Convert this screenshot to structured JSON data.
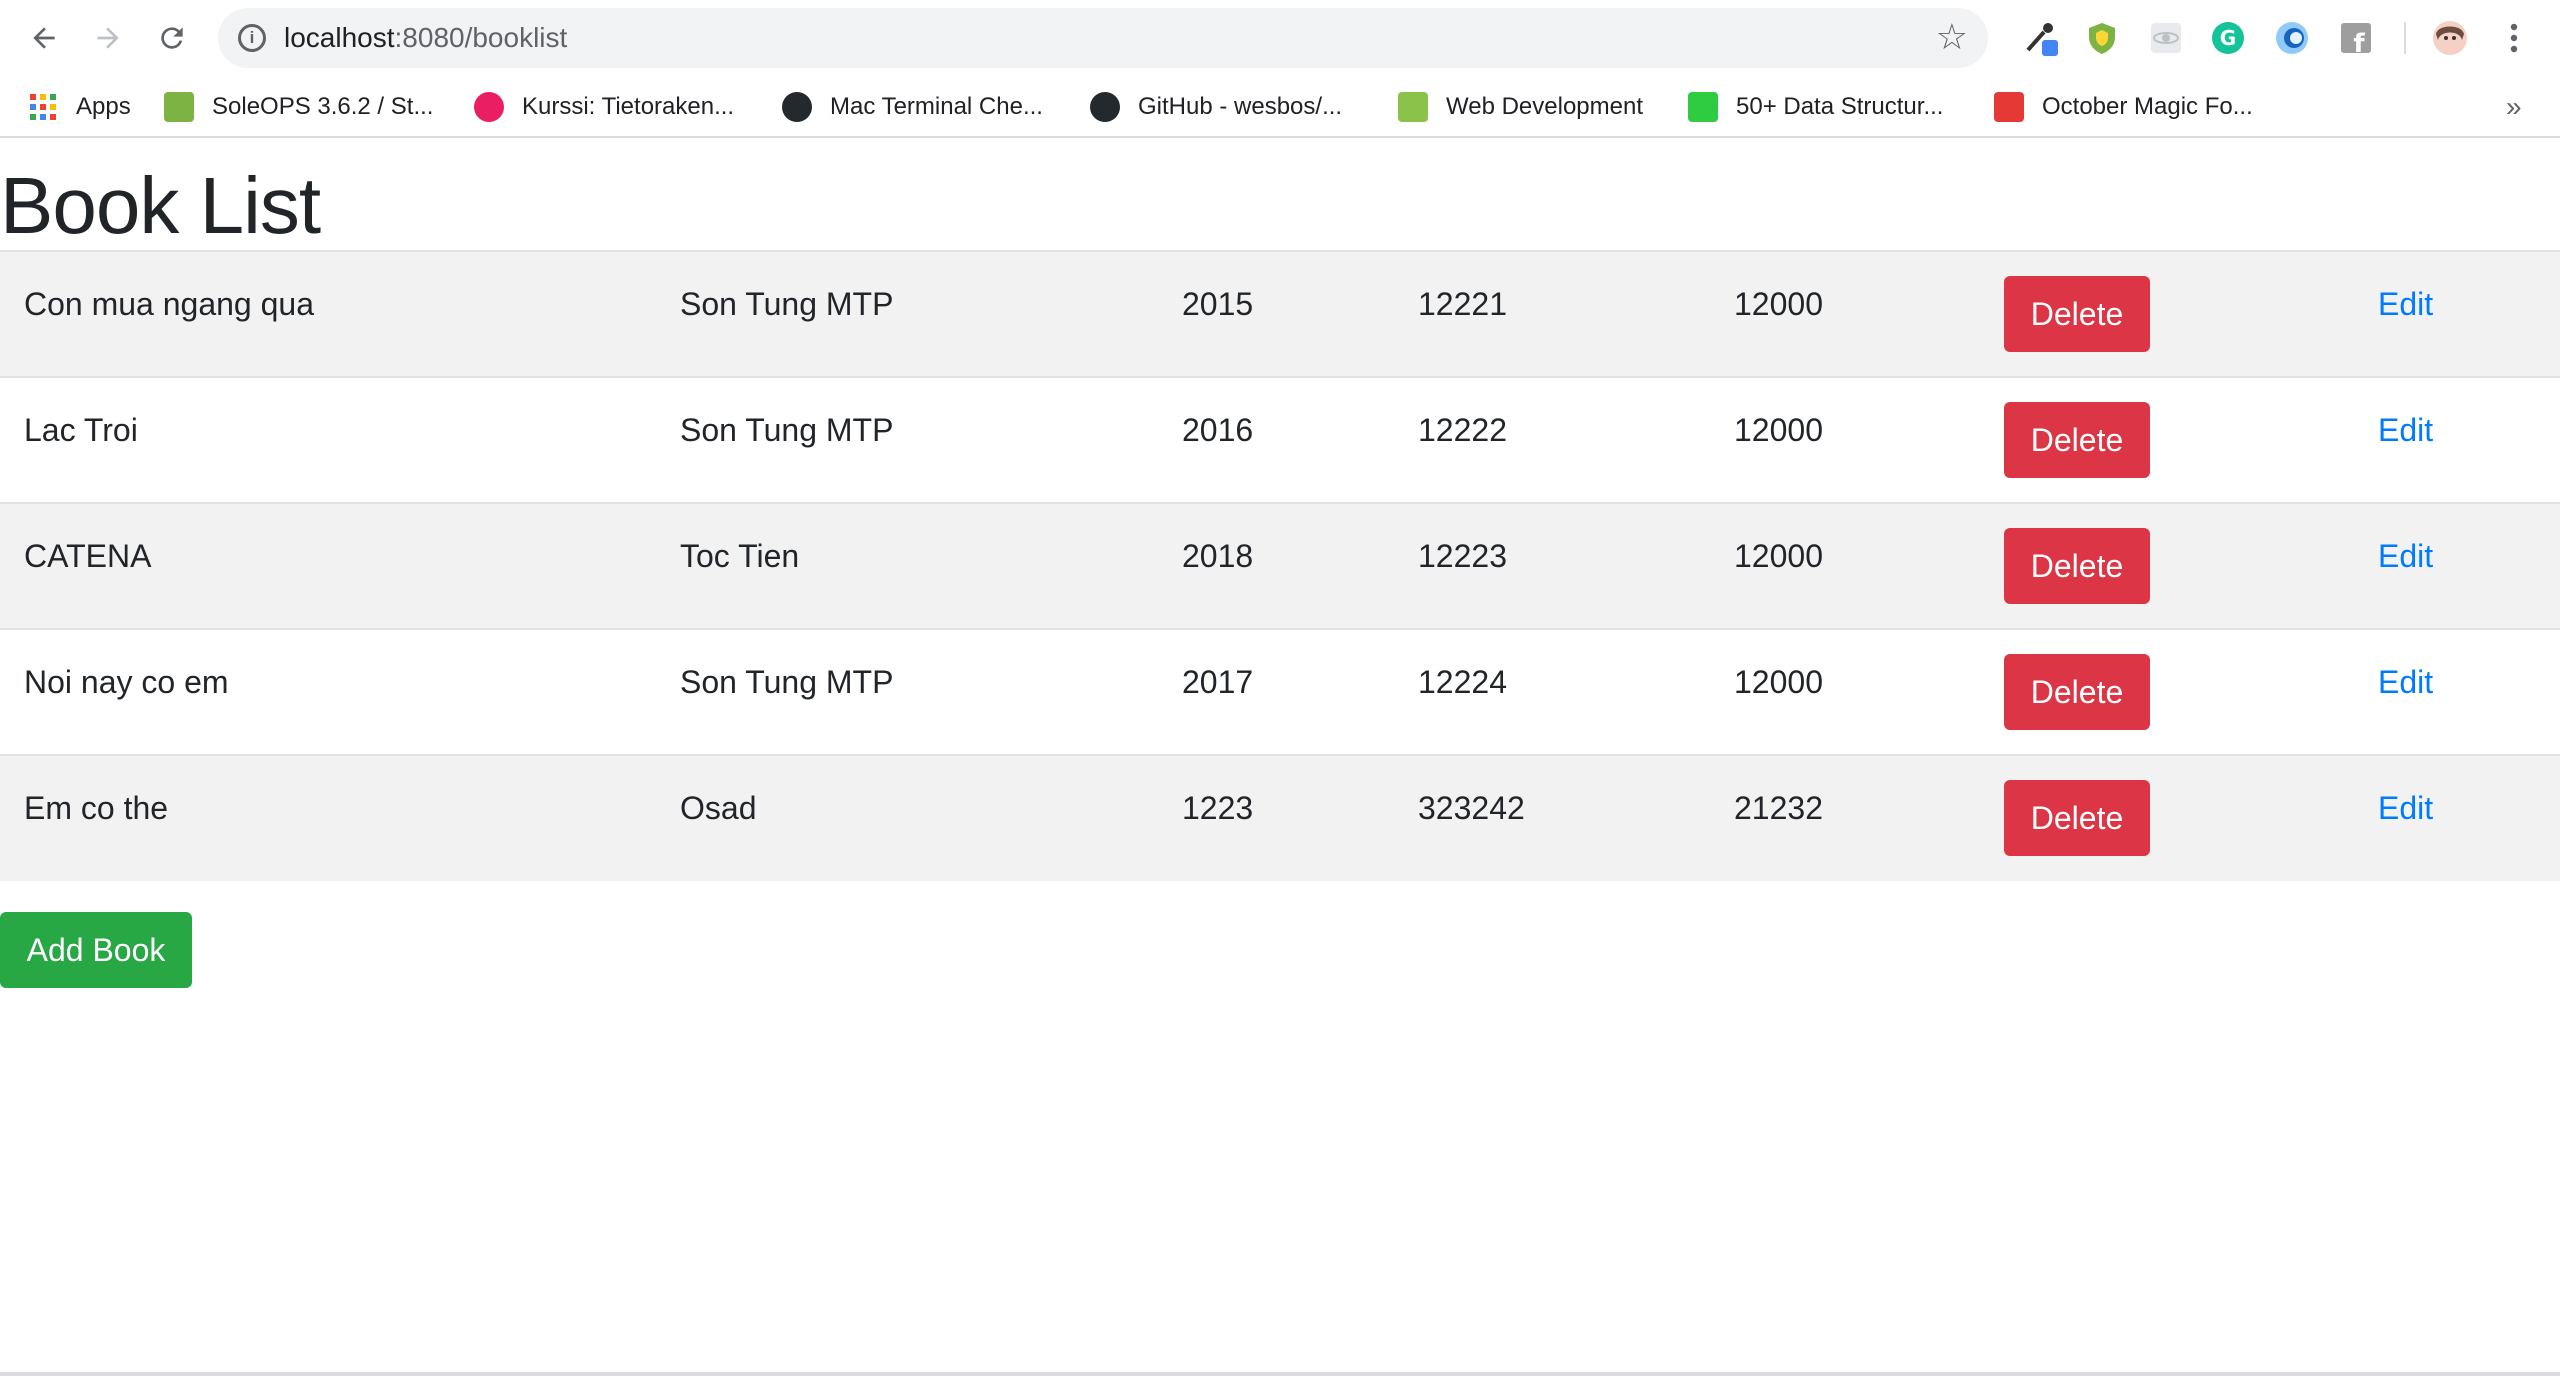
{
  "browser": {
    "url_host": "localhost",
    "url_path": ":8080/booklist",
    "bookmarks": [
      {
        "label": "Apps",
        "icon": "apps-grid-icon",
        "color": "#ea4335"
      },
      {
        "label": "SoleOPS 3.6.2 / St...",
        "icon": "soleops-icon",
        "color": "#7cb342"
      },
      {
        "label": "Kurssi: Tietoraken...",
        "icon": "kurssi-icon",
        "color": "#e91e63"
      },
      {
        "label": "Mac Terminal Che...",
        "icon": "github-icon",
        "color": "#24292e"
      },
      {
        "label": "GitHub - wesbos/...",
        "icon": "github-icon",
        "color": "#24292e"
      },
      {
        "label": "Web Development",
        "icon": "webdev-icon",
        "color": "#8bc34a"
      },
      {
        "label": "50+ Data Structur...",
        "icon": "data-structures-icon",
        "color": "#2ecc40"
      },
      {
        "label": "October Magic Fo...",
        "icon": "october-magic-icon",
        "color": "#e53935"
      }
    ],
    "overflow": "»"
  },
  "page": {
    "title": "Book List",
    "add_label": "Add Book",
    "delete_label": "Delete",
    "edit_label": "Edit",
    "rows": [
      {
        "title": "Con mua ngang qua",
        "author": "Son Tung MTP",
        "year": "2015",
        "isbn": "12221",
        "price": "12000"
      },
      {
        "title": "Lac Troi",
        "author": "Son Tung MTP",
        "year": "2016",
        "isbn": "12222",
        "price": "12000"
      },
      {
        "title": "CATENA",
        "author": "Toc Tien",
        "year": "2018",
        "isbn": "12223",
        "price": "12000"
      },
      {
        "title": "Noi nay co em",
        "author": "Son Tung MTP",
        "year": "2017",
        "isbn": "12224",
        "price": "12000"
      },
      {
        "title": "Em co the",
        "author": "Osad",
        "year": "1223",
        "isbn": "323242",
        "price": "21232"
      }
    ]
  },
  "colors": {
    "delete": "#dc3545",
    "add": "#28a745",
    "link": "#007bff"
  }
}
